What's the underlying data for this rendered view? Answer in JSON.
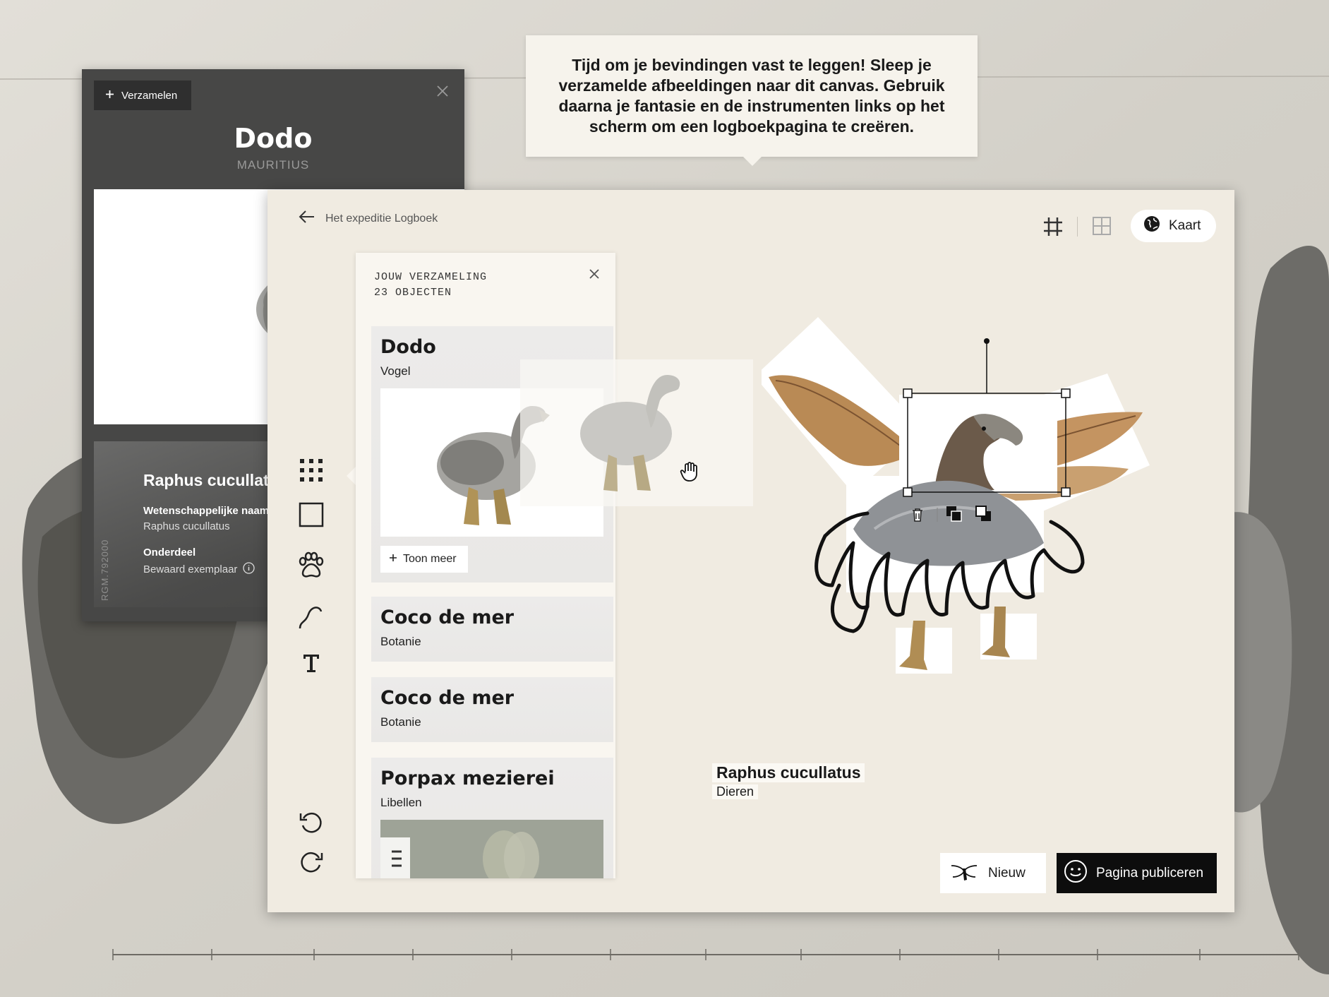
{
  "colors": {
    "accent": "#0d0d0d",
    "panel": "#f0ebe1",
    "dark_card": "#474746"
  },
  "back_card": {
    "collect_label": "Verzamelen",
    "title": "Dodo",
    "subtitle": "MAURITIUS",
    "scientific_name": "Raphus cucullatus",
    "fields": [
      {
        "label": "Wetenschappelijke naam",
        "value": "Raphus cucullatus"
      },
      {
        "label": "Onderdeel",
        "value": "Bewaard exemplaar"
      }
    ],
    "id_code": "RGM.792000"
  },
  "tooltip": {
    "text": "Tijd om je bevindingen vast te leggen! Sleep je verzamelde afbeeldingen naar dit canvas. Gebruik daarna je fantasie en de instrumenten links op het scherm om een logboekpagina te creëren."
  },
  "toolbar": {
    "back_label": "Het expeditie Logboek",
    "map_label": "Kaart"
  },
  "tools": [
    "grid-dots-icon",
    "square-icon",
    "paw-icon",
    "curve-icon",
    "text-icon",
    "undo-icon",
    "redo-icon"
  ],
  "collection": {
    "heading": "JOUW VERZAMELING",
    "count": "23 OBJECTEN",
    "more_label": "Toon meer",
    "items": [
      {
        "title": "Dodo",
        "category": "Vogel"
      },
      {
        "title": "Coco de mer",
        "category": "Botanie"
      },
      {
        "title": "Coco de mer",
        "category": "Botanie"
      },
      {
        "title": "Porpax mezierei",
        "category": "Libellen"
      }
    ]
  },
  "canvas": {
    "caption_title": "Raphus cucullatus",
    "caption_sub": "Dieren"
  },
  "actions": {
    "new_label": "Nieuw",
    "publish_label": "Pagina publiceren"
  }
}
